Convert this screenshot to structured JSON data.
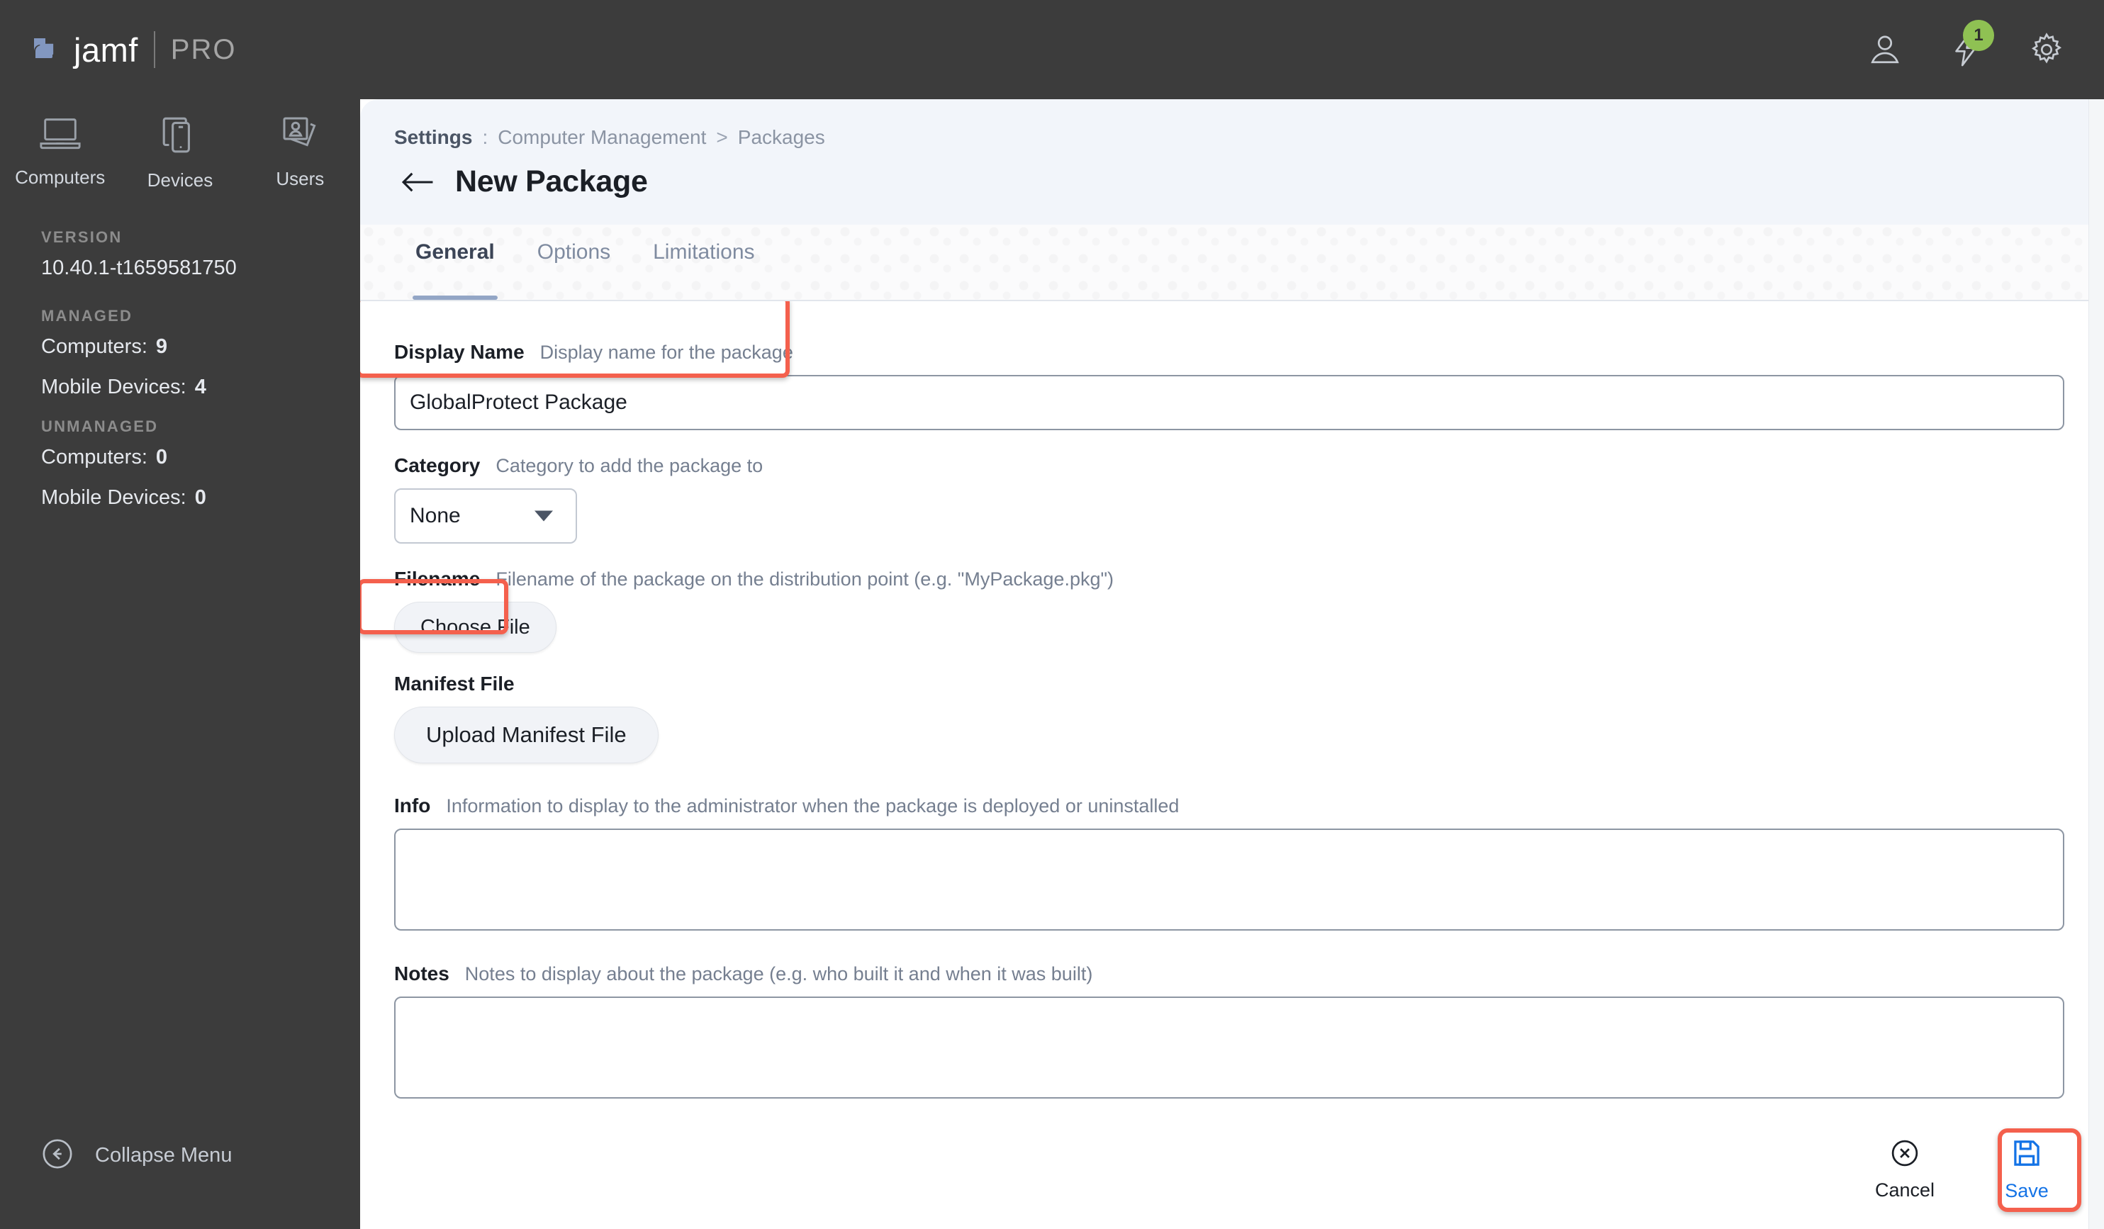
{
  "brand": {
    "name": "jamf",
    "product": "PRO"
  },
  "topbar": {
    "icons": [
      {
        "name": "user-icon",
        "label": "User"
      },
      {
        "name": "notifications-bolt-icon",
        "label": "Notifications",
        "badge": "1"
      },
      {
        "name": "gear-icon",
        "label": "Settings"
      }
    ],
    "badge_color": "#8fc153"
  },
  "sidebar": {
    "nav": [
      {
        "label": "Computers",
        "icon": "laptop-icon"
      },
      {
        "label": "Devices",
        "icon": "mobile-devices-icon"
      },
      {
        "label": "Users",
        "icon": "user-cards-icon"
      }
    ],
    "version_heading": "VERSION",
    "version_value": "10.40.1-t1659581750",
    "managed_heading": "MANAGED",
    "managed": [
      {
        "label": "Computers:",
        "value": "9"
      },
      {
        "label": "Mobile Devices:",
        "value": "4"
      }
    ],
    "unmanaged_heading": "UNMANAGED",
    "unmanaged": [
      {
        "label": "Computers:",
        "value": "0"
      },
      {
        "label": "Mobile Devices:",
        "value": "0"
      }
    ],
    "collapse_label": "Collapse Menu"
  },
  "breadcrumb": {
    "root": "Settings",
    "colon": ":",
    "section": "Computer Management",
    "chevron": ">",
    "page": "Packages"
  },
  "page": {
    "title": "New Package",
    "back_icon": "back-arrow-icon"
  },
  "tabs": [
    {
      "label": "General",
      "active": true
    },
    {
      "label": "Options",
      "active": false
    },
    {
      "label": "Limitations",
      "active": false
    }
  ],
  "form": {
    "display_name": {
      "label": "Display Name",
      "help": "Display name for the package",
      "value": "GlobalProtect Package",
      "placeholder": ""
    },
    "category": {
      "label": "Category",
      "help": "Category to add the package to",
      "value": "None"
    },
    "filename": {
      "label": "Filename",
      "help": "Filename of the package on the distribution point (e.g. \"MyPackage.pkg\")",
      "button": "Choose File"
    },
    "manifest": {
      "label": "Manifest File",
      "button": "Upload Manifest File"
    },
    "info": {
      "label": "Info",
      "help": "Information to display to the administrator when the package is deployed or uninstalled",
      "value": "",
      "placeholder": ""
    },
    "notes": {
      "label": "Notes",
      "help": "Notes to display about the package (e.g. who built it and when it was built)",
      "value": "",
      "placeholder": ""
    }
  },
  "actions": {
    "cancel": {
      "label": "Cancel",
      "icon": "cancel-circle-x-icon"
    },
    "save": {
      "label": "Save",
      "icon": "save-floppy-icon",
      "color": "#1473e6"
    }
  },
  "annotations": {
    "color": "#f4604d"
  }
}
